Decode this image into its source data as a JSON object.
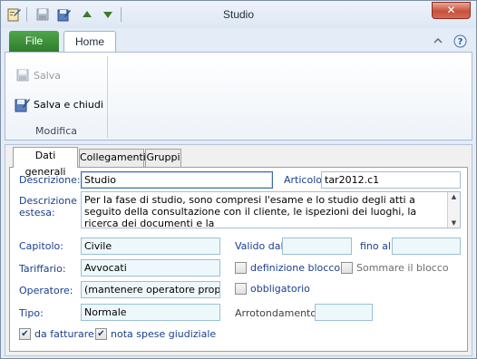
{
  "window": {
    "title": "Studio"
  },
  "quick_access": {
    "icons": [
      "app-icon",
      "save-icon",
      "save-close-icon",
      "up-arrow-icon",
      "down-arrow-icon"
    ]
  },
  "ribbon": {
    "file_tab": "File",
    "home_tab": "Home",
    "items": {
      "salva": "Salva",
      "salva_chiudi": "Salva e chiudi"
    },
    "group_label": "Modifica"
  },
  "tabs": [
    "Dati generali",
    "Collegamenti",
    "Gruppi"
  ],
  "form": {
    "descrizione": {
      "label": "Descrizione:",
      "value": "Studio"
    },
    "articolo": {
      "label": "Articolo:",
      "value": "tar2012.c1"
    },
    "descrizione_estesa": {
      "label_line1": "Descrizione",
      "label_line2": "estesa:",
      "value": "Per la fase di studio, sono compresi l'esame e lo studio degli atti a seguito della consultazione con il cliente, le ispezioni dei luoghi, la ricerca dei documenti e la"
    },
    "capitolo": {
      "label": "Capitolo:",
      "value": "Civile"
    },
    "valido_dal": {
      "label": "Valido dal:",
      "value": ""
    },
    "fino_al": {
      "label": "fino al:",
      "value": ""
    },
    "tariffario": {
      "label": "Tariffario:",
      "value": "Avvocati"
    },
    "definizione_blocco": {
      "label": "definizione blocco",
      "checked": false
    },
    "sommare_blocco": {
      "label": "Sommare il blocco",
      "checked": false
    },
    "operatore": {
      "label": "Operatore:",
      "value": "(mantenere operatore propost"
    },
    "obbligatorio": {
      "label": "obbligatorio",
      "checked": false
    },
    "tipo": {
      "label": "Tipo:",
      "value": "Normale"
    },
    "arrotondamento": {
      "label": "Arrotondamento:",
      "value": ""
    },
    "da_fatturare": {
      "label": "da fatturare",
      "checked": true
    },
    "nota_spese": {
      "label": "nota spese giudiziale",
      "checked": true
    }
  },
  "colors": {
    "accent": "#1a3f8f",
    "file_tab": "#2e7d2e",
    "close": "#c9503c"
  }
}
